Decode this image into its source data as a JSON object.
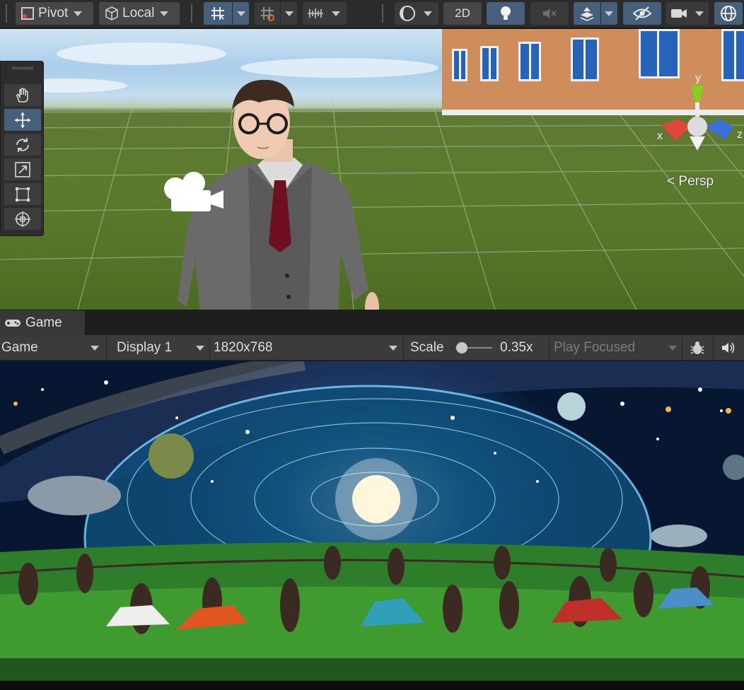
{
  "toolbar": {
    "pivot_label": "Pivot",
    "local_label": "Local",
    "mode_2d_label": "2D",
    "icons": [
      "pivot-icon",
      "local-cube-icon",
      "grid-snap-icon",
      "increment-snap-icon",
      "ruler-icon",
      "draw-mode-icon",
      "light-bulb-icon",
      "audio-mute-icon",
      "effects-icon",
      "visibility-icon",
      "scene-camera-icon",
      "gizmos-icon"
    ]
  },
  "scene": {
    "persp_label": "Persp",
    "axis_labels": {
      "x": "x",
      "y": "y",
      "z": "z"
    },
    "tools": [
      "hand-tool-icon",
      "move-tool-icon",
      "rotate-tool-icon",
      "scale-tool-icon",
      "rect-tool-icon",
      "transform-tool-icon"
    ],
    "active_tool": "move-tool-icon"
  },
  "game_panel": {
    "tab_label": "Game",
    "view_select": "Game",
    "display_select": "Display 1",
    "resolution_select": "1820x768",
    "scale_label": "Scale",
    "scale_value": "0.35x",
    "scale_fraction": 0.1,
    "play_mode_select": "Play Focused"
  },
  "colors": {
    "toolbar_bg": "#2b2b2b",
    "button_bg": "#474747",
    "active_blue": "#46607c",
    "axis_x": "#e0463a",
    "axis_y": "#7ed321",
    "axis_z": "#3a6fdc"
  }
}
